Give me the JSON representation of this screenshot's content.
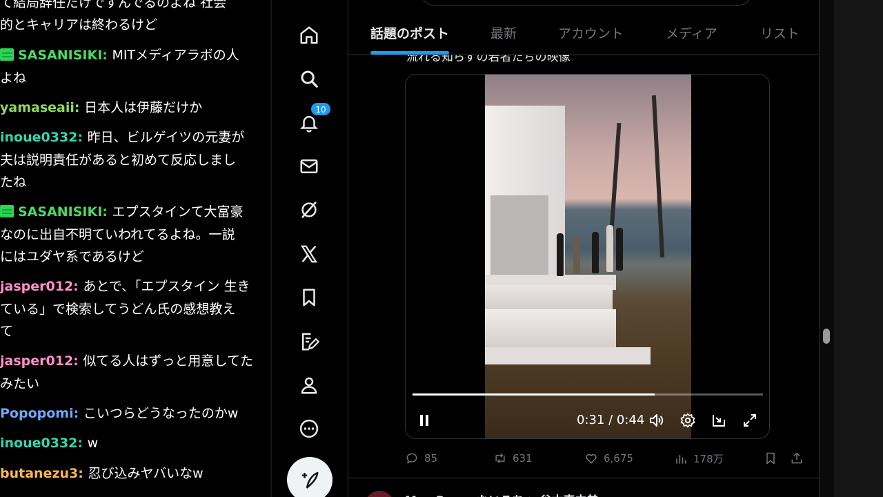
{
  "chat": {
    "top_fragment_1": "て結局辞任だけですんでるのよね 社会",
    "top_fragment_2": "的とキャリアは終わるけど",
    "messages": [
      {
        "user": "SASANISIKI",
        "badge": true,
        "color": "#4cd964",
        "text": "MITメディアラボの人",
        "cont": "よね"
      },
      {
        "user": "yamaseaii",
        "badge": false,
        "color": "#8fdc5a",
        "text": "日本人は伊藤だけか",
        "cont": ""
      },
      {
        "user": "inoue0332",
        "badge": false,
        "color": "#33d6b0",
        "text": "昨日、ビルゲイツの元妻が",
        "cont": "夫は説明責任があると初めて反応しまし",
        "cont2": "たね"
      },
      {
        "user": "SASANISIKI",
        "badge": true,
        "color": "#4cd964",
        "text": "エプスタインて大富豪",
        "cont": "なのに出自不明ていわれてるよね。一説",
        "cont2": "にはユダヤ系であるけど"
      },
      {
        "user": "jasper012",
        "badge": false,
        "color": "#ff8fc8",
        "text": "あとで、「エプスタイン 生き",
        "cont": "ている」で検索してうどん氏の感想教え",
        "cont2": "て"
      },
      {
        "user": "jasper012",
        "badge": false,
        "color": "#ff8fc8",
        "text": "似てる人はずっと用意してた",
        "cont": "みたい"
      },
      {
        "user": "Popopomi",
        "badge": false,
        "color": "#6fa8ff",
        "text": "こいつらどうなったのかw",
        "cont": ""
      },
      {
        "user": "inoue0332",
        "badge": false,
        "color": "#33d6b0",
        "text": "w",
        "cont": ""
      },
      {
        "user": "butanezu3",
        "badge": false,
        "color": "#ffb84d",
        "text": "忍び込みヤバいなw",
        "cont": ""
      }
    ]
  },
  "nav": {
    "notification_count": "10"
  },
  "tabs": [
    "話題のポスト",
    "最新",
    "アカウント",
    "メディア",
    "リスト"
  ],
  "post": {
    "caption": "流れる知らずの若者たちの映像",
    "video": {
      "time": "0:31 / 0:44",
      "progress": 0.69
    },
    "actions": {
      "replies": "85",
      "reposts": "631",
      "likes": "6,675",
      "views": "178万"
    }
  },
  "next_post": {
    "name": "May Rama ないろちゃ 谷本真由美"
  },
  "colors": {
    "accent": "#1d9bf0",
    "muted": "#71767b"
  },
  "icons": [
    "home-icon",
    "search-icon",
    "bell-icon",
    "mail-icon",
    "grok-icon",
    "x-logo-icon",
    "bookmark-icon",
    "edit-note-icon",
    "person-icon",
    "more-icon",
    "compose-icon",
    "pause-icon",
    "volume-icon",
    "gear-icon",
    "pip-icon",
    "fullscreen-icon",
    "reply-icon",
    "repost-icon",
    "like-icon",
    "views-icon",
    "share-icon"
  ]
}
